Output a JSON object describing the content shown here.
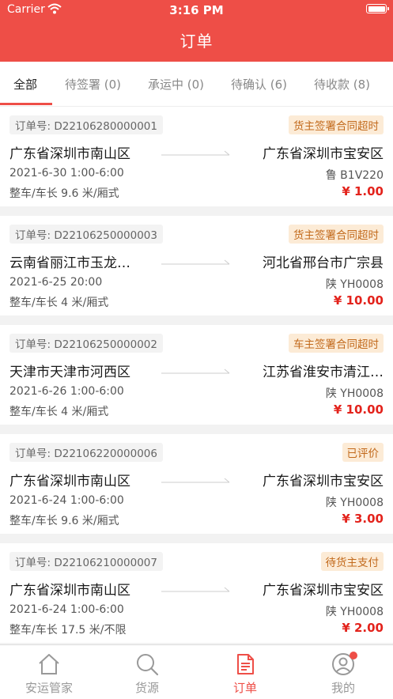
{
  "status_bar": {
    "carrier": "Carrier",
    "time": "3:16 PM"
  },
  "header": {
    "title": "订单"
  },
  "tabs": [
    {
      "label": "全部",
      "active": true
    },
    {
      "label": "待签署 (0)"
    },
    {
      "label": "承运中 (0)"
    },
    {
      "label": "待确认 (6)"
    },
    {
      "label": "待收款 (8)"
    }
  ],
  "orders": [
    {
      "order_no": "订单号: D22106280000001",
      "status": "货主签署合同超时",
      "from": "广东省深圳市南山区",
      "to": "广东省深圳市宝安区",
      "date": "2021-6-30  1:00-6:00",
      "plate": "鲁 B1V220",
      "spec": "整车/车长 9.6 米/厢式",
      "price": "¥ 1.00"
    },
    {
      "order_no": "订单号: D22106250000003",
      "status": "货主签署合同超时",
      "from": "云南省丽江市玉龙…",
      "to": "河北省邢台市广宗县",
      "date": "2021-6-25  20:00",
      "plate": "陕 YH0008",
      "spec": "整车/车长 4 米/厢式",
      "price": "¥ 10.00"
    },
    {
      "order_no": "订单号: D22106250000002",
      "status": "车主签署合同超时",
      "from": "天津市天津市河西区",
      "to": "江苏省淮安市清江…",
      "date": "2021-6-26  1:00-6:00",
      "plate": "陕 YH0008",
      "spec": "整车/车长 4 米/厢式",
      "price": "¥ 10.00"
    },
    {
      "order_no": "订单号: D22106220000006",
      "status": "已评价",
      "from": "广东省深圳市南山区",
      "to": "广东省深圳市宝安区",
      "date": "2021-6-24  1:00-6:00",
      "plate": "陕 YH0008",
      "spec": "整车/车长 9.6 米/厢式",
      "price": "¥ 3.00"
    },
    {
      "order_no": "订单号: D22106210000007",
      "status": "待货主支付",
      "from": "广东省深圳市南山区",
      "to": "广东省深圳市宝安区",
      "date": "2021-6-24  1:00-6:00",
      "plate": "陕 YH0008",
      "spec": "整车/车长 17.5 米/不限",
      "price": "¥ 2.00"
    }
  ],
  "tabbar": [
    {
      "label": "安运管家",
      "icon": "home-icon"
    },
    {
      "label": "货源",
      "icon": "search-icon"
    },
    {
      "label": "订单",
      "icon": "document-icon",
      "active": true
    },
    {
      "label": "我的",
      "icon": "person-icon",
      "badge": true
    }
  ],
  "colors": {
    "brand": "#ee4e47",
    "price": "#e3231c",
    "badge_bg": "#fcebd6",
    "badge_text": "#c26a1c"
  }
}
